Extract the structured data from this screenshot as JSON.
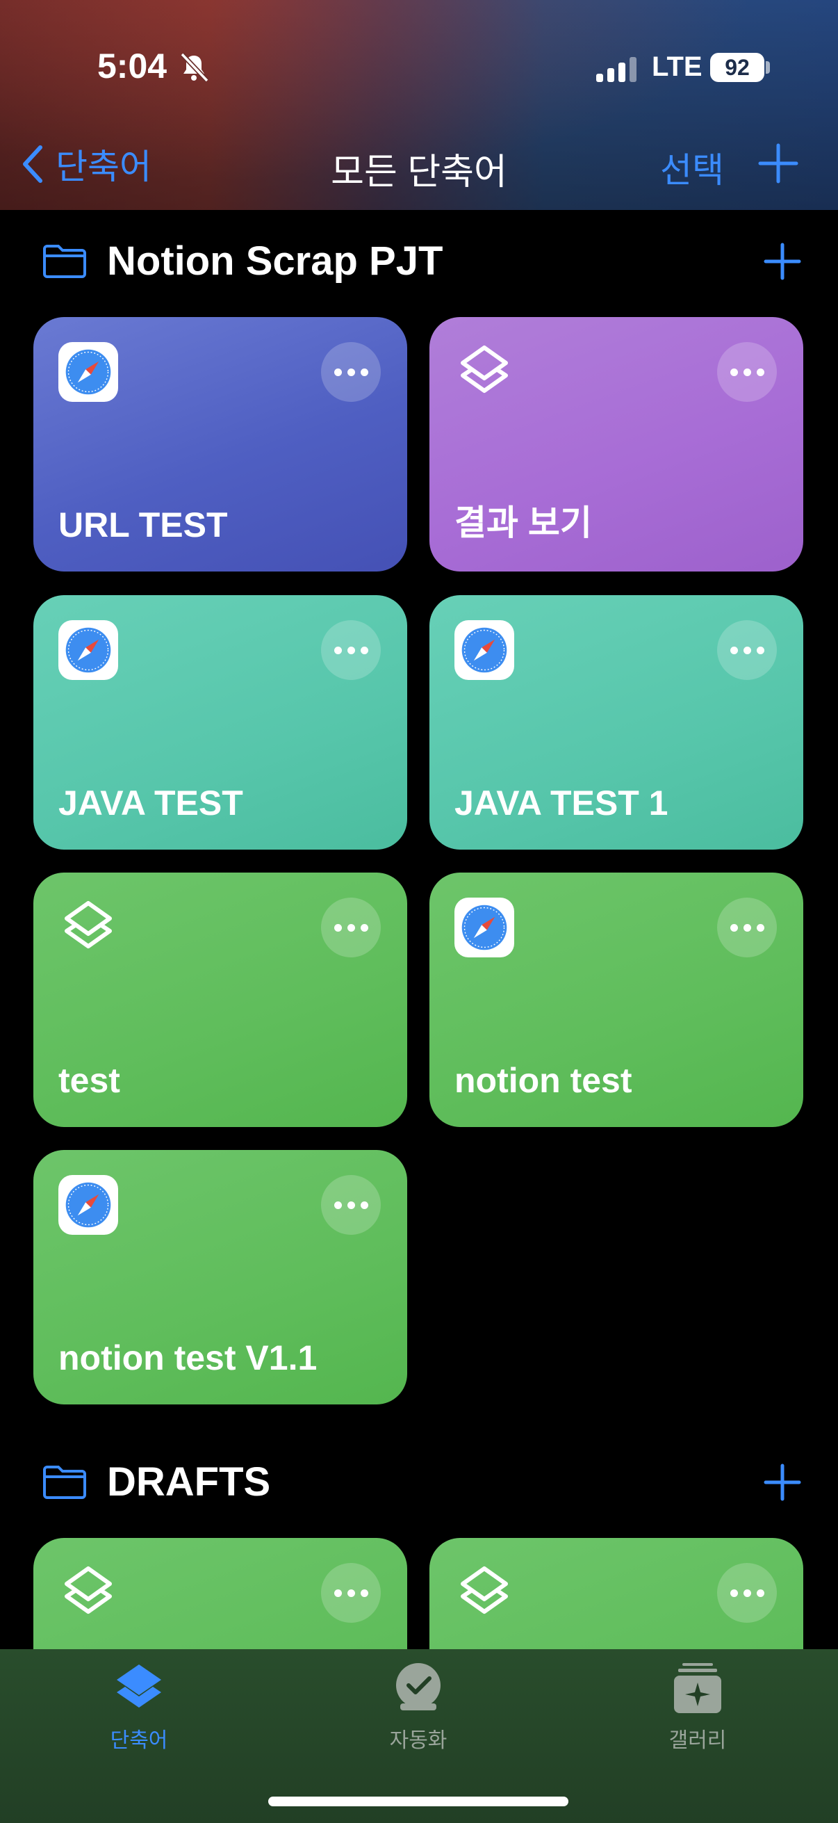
{
  "status_bar": {
    "time": "5:04",
    "network": "LTE",
    "battery": "92"
  },
  "nav": {
    "back_label": "단축어",
    "title": "모든 단축어",
    "select_label": "선택"
  },
  "sections": [
    {
      "title": "Notion Scrap PJT",
      "cards": [
        {
          "title": "URL TEST",
          "color": "#5667c7",
          "icon": "safari-icon"
        },
        {
          "title": "결과 보기",
          "color": "#a96ed6",
          "icon": "layers-icon"
        },
        {
          "title": "JAVA TEST",
          "color": "#57c6ab",
          "icon": "safari-icon"
        },
        {
          "title": "JAVA TEST 1",
          "color": "#57c6ab",
          "icon": "safari-icon"
        },
        {
          "title": "test",
          "color": "#5fbd5b",
          "icon": "layers-icon"
        },
        {
          "title": "notion test",
          "color": "#5fbd5b",
          "icon": "safari-icon"
        },
        {
          "title": "notion test V1.1",
          "color": "#5fbd5b",
          "icon": "safari-icon"
        }
      ]
    },
    {
      "title": "DRAFTS",
      "cards": [
        {
          "title": "",
          "color": "#5fbd5b",
          "icon": "layers-icon"
        },
        {
          "title": "",
          "color": "#5fbd5b",
          "icon": "layers-icon"
        }
      ]
    }
  ],
  "tabs": [
    {
      "label": "단축어",
      "icon": "layers-icon",
      "active": true
    },
    {
      "label": "자동화",
      "icon": "checkmark-clock-icon",
      "active": false
    },
    {
      "label": "갤러리",
      "icon": "gallery-sparkle-icon",
      "active": false
    }
  ],
  "colors": {
    "accent": "#3b8cff",
    "tab_inactive": "#9aa59b"
  }
}
